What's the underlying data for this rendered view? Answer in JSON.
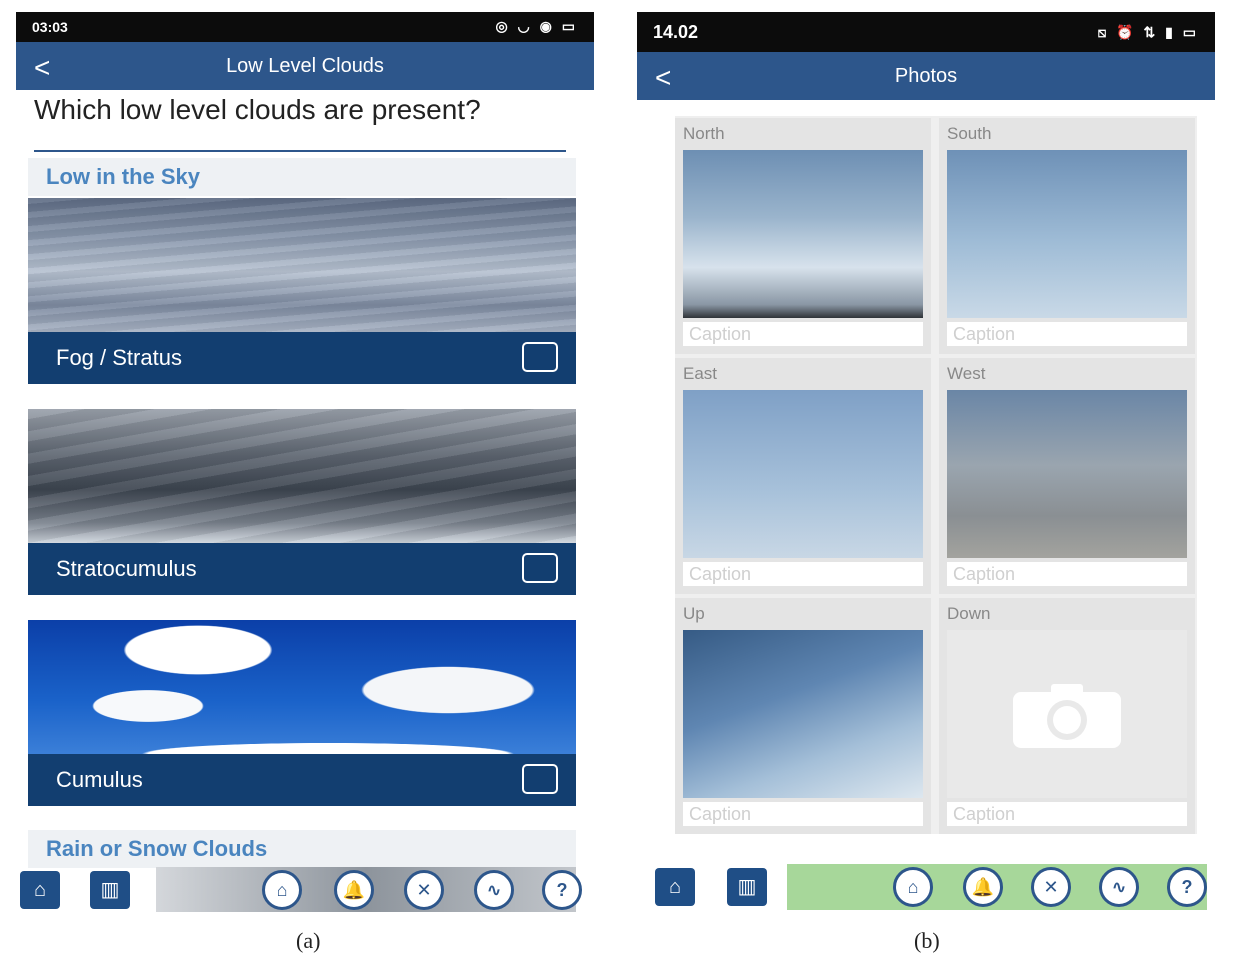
{
  "panel_a": {
    "status": {
      "time": "03:03",
      "right_icons": "◎ ◡ ◉ ▭"
    },
    "nav": {
      "back": "<",
      "title": "Low Level Clouds"
    },
    "question": "Which low level clouds are present?",
    "section_1": "Low in the Sky",
    "clouds": [
      {
        "label": "Fog / Stratus"
      },
      {
        "label": "Stratocumulus"
      },
      {
        "label": "Cumulus"
      }
    ],
    "section_2": "Rain or Snow Clouds",
    "bottom": {
      "home": "⌂",
      "chart": "▥",
      "round": [
        "⌂",
        "🔔",
        "✕",
        "∿",
        "?"
      ]
    },
    "figure_label": "(a)"
  },
  "panel_b": {
    "status": {
      "time": "14.02",
      "right_icons": "⧅ ⏰ ⇅ ▮ ▭"
    },
    "nav": {
      "back": "<",
      "title": "Photos"
    },
    "cells": [
      {
        "direction": "North",
        "caption": "Caption"
      },
      {
        "direction": "South",
        "caption": "Caption"
      },
      {
        "direction": "East",
        "caption": "Caption"
      },
      {
        "direction": "West",
        "caption": "Caption"
      },
      {
        "direction": "Up",
        "caption": "Caption"
      },
      {
        "direction": "Down",
        "caption": "Caption"
      }
    ],
    "bottom": {
      "home": "⌂",
      "chart": "▥",
      "round": [
        "⌂",
        "🔔",
        "✕",
        "∿",
        "?"
      ]
    },
    "figure_label": "(b)"
  },
  "colors": {
    "nav": "#2d568b",
    "card_bar": "#123e70",
    "section_text": "#4a85bf"
  }
}
